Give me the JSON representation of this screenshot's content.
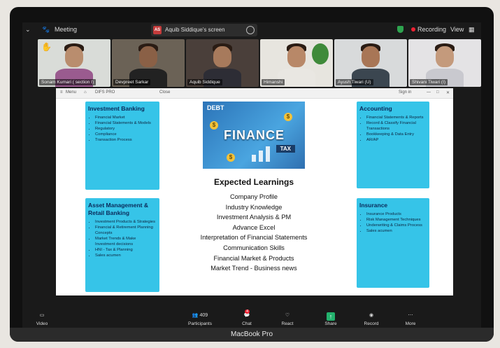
{
  "topbar": {
    "meeting_label": "Meeting",
    "share_initials": "AS",
    "share_text": "Aquib Siddique's screen",
    "recording": "Recording",
    "view": "View"
  },
  "participants": [
    {
      "name": "Sonam Kumari ( section I)",
      "active": true
    },
    {
      "name": "Devpreet Sarkar"
    },
    {
      "name": "Aquib Siddique"
    },
    {
      "name": "Himanshi"
    },
    {
      "name": "Ayush Tiwari (U)"
    },
    {
      "name": "Shivani Tiwari (I)"
    }
  ],
  "browser": {
    "menu": "Menu",
    "tab": "DIFS PRO",
    "close": "Close",
    "signin": "Sign in"
  },
  "slide": {
    "cards": {
      "investment": {
        "title": "Investment Banking",
        "items": [
          "Financial Market",
          "Financial Statements & Models",
          "Regulatory",
          "Compliance",
          "Transaction Process"
        ]
      },
      "asset": {
        "title": "Asset Management & Retail Banking",
        "items": [
          "Investment Products & Strategies",
          "Financial & Retirement Planning Concepts",
          "Market Trends & Make Investment decisions",
          "HNI - Tax & Planning",
          "Sales acumen"
        ]
      },
      "accounting": {
        "title": "Accounting",
        "items": [
          "Financial Statements & Reports",
          "Record & Classify Financial Transactions",
          "Bookkeeping & Data Entry",
          "AR/AP"
        ]
      },
      "insurance": {
        "title": "Insurance",
        "items": [
          "Insurance Products",
          "Risk Management Techniques",
          "Underwriting & Claims Process",
          "Sales acumen"
        ]
      }
    },
    "image": {
      "word": "FINANCE",
      "tax": "TAX",
      "debt": "DEBT"
    },
    "expected_title": "Expected Learnings",
    "learnings": [
      "Company Profile",
      "Industry Knowledge",
      "Investment Analysis & PM",
      "Advance Excel",
      "Interpretation of Financial Statements",
      "Communication Skills",
      "Financial Market & Products",
      "Market Trend - Business news"
    ]
  },
  "toolbar": {
    "video": "Video",
    "participants": "Participants",
    "participants_count": "409",
    "chat": "Chat",
    "chat_badge": "4",
    "react": "React",
    "share": "Share",
    "record": "Record",
    "more": "More"
  },
  "device_label": "MacBook Pro"
}
